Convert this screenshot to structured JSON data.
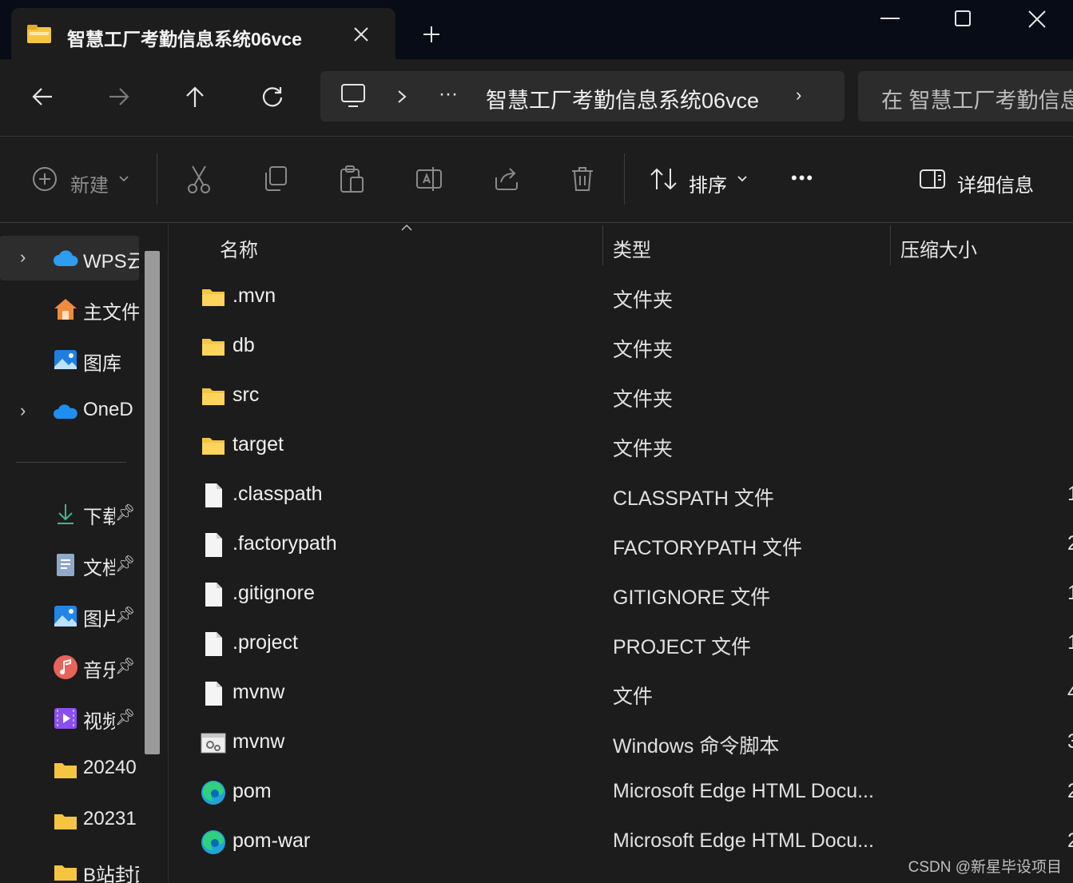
{
  "window": {
    "tab_title": "智慧工厂考勤信息系统06vce",
    "tab_close_icon": "close-icon",
    "new_tab_icon": "plus-icon",
    "controls": [
      "minimize-icon",
      "maximize-icon",
      "close-icon"
    ]
  },
  "nav": {
    "back_icon": "arrow-left-icon",
    "forward_icon": "arrow-right-icon",
    "up_icon": "arrow-up-icon",
    "refresh_icon": "refresh-icon",
    "address": {
      "computer_icon": "monitor-icon",
      "breadcrumb_ellipsis": "···",
      "current_folder": "智慧工厂考勤信息系统06vce",
      "trailing_chevron": "›"
    },
    "search_placeholder": "在 智慧工厂考勤信息"
  },
  "commandbar": {
    "new_label": "新建",
    "sort_label": "排序",
    "more_label": "•••",
    "details_label": "详细信息"
  },
  "sidebar": {
    "items": [
      {
        "label": "WPS云",
        "icon": "cloud-icon",
        "expandable": true
      },
      {
        "label": "主文件",
        "icon": "home-icon",
        "expandable": false
      },
      {
        "label": "图库",
        "icon": "gallery-icon",
        "expandable": false
      },
      {
        "label": "OneD",
        "icon": "onedrive-icon",
        "expandable": true
      }
    ],
    "pinned": [
      {
        "label": "下载",
        "icon": "download-icon"
      },
      {
        "label": "文档",
        "icon": "document-icon"
      },
      {
        "label": "图片",
        "icon": "pictures-icon"
      },
      {
        "label": "音乐",
        "icon": "music-icon"
      },
      {
        "label": "视频",
        "icon": "video-icon"
      }
    ],
    "folders": [
      {
        "label": "20240",
        "icon": "folder-icon"
      },
      {
        "label": "20231",
        "icon": "folder-icon"
      },
      {
        "label": "B站封面",
        "icon": "folder-icon"
      }
    ]
  },
  "columns": {
    "name": "名称",
    "type": "类型",
    "compressed_size": "压缩大小"
  },
  "files": [
    {
      "name": ".mvn",
      "type": "文件夹",
      "size": "",
      "icon": "folder-icon"
    },
    {
      "name": "db",
      "type": "文件夹",
      "size": "",
      "icon": "folder-icon"
    },
    {
      "name": "src",
      "type": "文件夹",
      "size": "",
      "icon": "folder-icon"
    },
    {
      "name": "target",
      "type": "文件夹",
      "size": "",
      "icon": "folder-icon"
    },
    {
      "name": ".classpath",
      "type": "CLASSPATH 文件",
      "size": "1",
      "icon": "file-icon"
    },
    {
      "name": ".factorypath",
      "type": "FACTORYPATH 文件",
      "size": "2",
      "icon": "file-icon"
    },
    {
      "name": ".gitignore",
      "type": "GITIGNORE 文件",
      "size": "1",
      "icon": "file-icon"
    },
    {
      "name": ".project",
      "type": "PROJECT 文件",
      "size": "1",
      "icon": "file-icon"
    },
    {
      "name": "mvnw",
      "type": "文件",
      "size": "4",
      "icon": "file-icon"
    },
    {
      "name": "mvnw",
      "type": "Windows 命令脚本",
      "size": "3",
      "icon": "script-icon"
    },
    {
      "name": "pom",
      "type": "Microsoft Edge HTML Docu...",
      "size": "2",
      "icon": "edge-icon"
    },
    {
      "name": "pom-war",
      "type": "Microsoft Edge HTML Docu...",
      "size": "2",
      "icon": "edge-icon"
    }
  ],
  "watermark": "CSDN @新星毕设项目",
  "colors": {
    "titlebar": "#070c16",
    "background": "#1c1c1c",
    "panel": "#1d1d1d",
    "field": "#2c2c2c",
    "folder": "#f5c542"
  }
}
